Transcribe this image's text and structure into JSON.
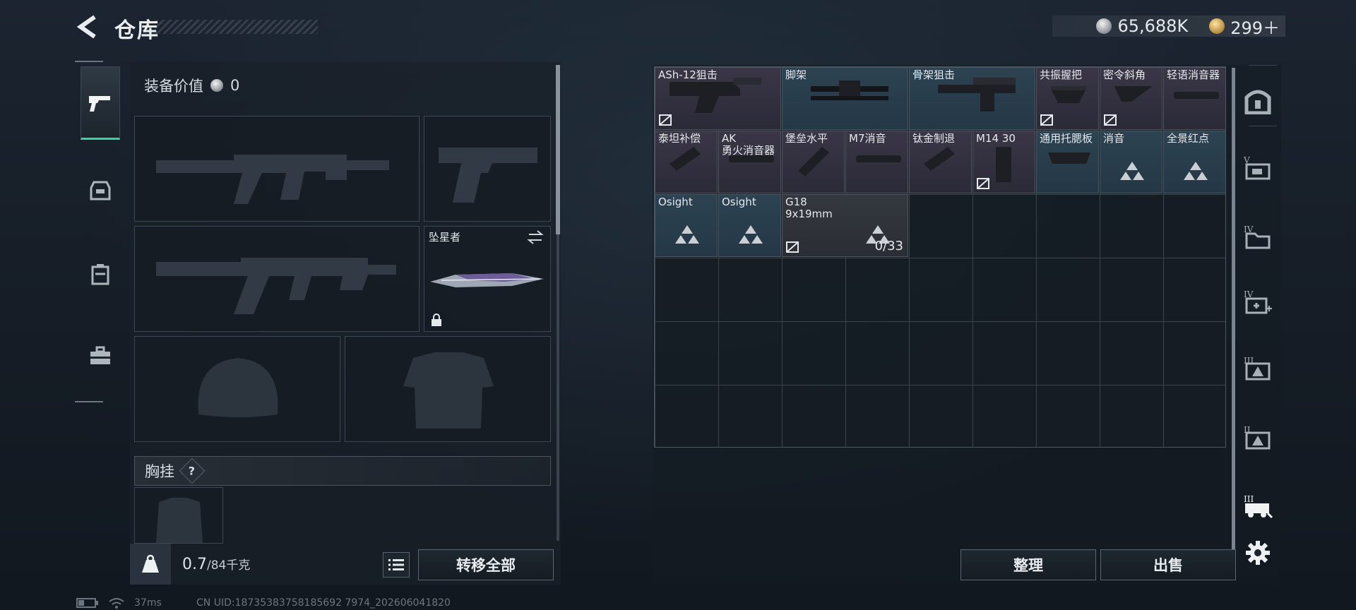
{
  "header": {
    "title": "仓库",
    "back_icon": "back-arrow-icon",
    "silver_amount": "65,688K",
    "gold_amount": "299＋"
  },
  "left_rail": [
    {
      "name": "weapons-tab",
      "icon": "pistol-icon",
      "active": true
    },
    {
      "name": "armor-tab",
      "icon": "helmet-icon",
      "active": false
    },
    {
      "name": "backpack-tab",
      "icon": "backpack-icon",
      "active": false
    },
    {
      "name": "toolbox-tab",
      "icon": "toolbox-icon",
      "active": false
    }
  ],
  "equipment": {
    "value_label": "装备价值",
    "value_amount": "0",
    "melee_name": "坠星者",
    "chest_label": "胸挂",
    "help_glyph": "?",
    "weight_current": "0.7",
    "weight_max": "/84千克",
    "transfer_all_label": "转移全部"
  },
  "stash": {
    "items": [
      {
        "name": "ASh-12狙击",
        "sub": "",
        "color": "purple",
        "locked": true
      },
      {
        "name": "脚架",
        "sub": "",
        "color": "blue",
        "locked": false
      },
      {
        "name": "骨架狙击",
        "sub": "",
        "color": "blue",
        "locked": false
      },
      {
        "name": "共振握把",
        "sub": "",
        "color": "purple",
        "locked": true
      },
      {
        "name": "密令斜角",
        "sub": "",
        "color": "purple",
        "locked": true
      },
      {
        "name": "轻语消音器",
        "sub": "",
        "color": "purple",
        "locked": false
      },
      {
        "name": "泰坦补偿",
        "sub": "",
        "color": "purple",
        "locked": false
      },
      {
        "name": "AK",
        "sub": "勇火消音器",
        "color": "purple",
        "locked": false
      },
      {
        "name": "堡垒水平",
        "sub": "",
        "color": "purple",
        "locked": false
      },
      {
        "name": "M7消音",
        "sub": "",
        "color": "purple",
        "locked": false
      },
      {
        "name": "钛金制退",
        "sub": "",
        "color": "purple",
        "locked": false
      },
      {
        "name": "M14 30",
        "sub": "",
        "color": "purple",
        "locked": true
      },
      {
        "name": "通用托腮板",
        "sub": "",
        "color": "blue",
        "locked": false
      },
      {
        "name": "消音",
        "sub": "",
        "color": "blue",
        "locked": false
      },
      {
        "name": "全景红点",
        "sub": "",
        "color": "blue",
        "locked": false
      },
      {
        "name": "Osight",
        "sub": "",
        "color": "blue",
        "locked": false
      },
      {
        "name": "Osight",
        "sub": "",
        "color": "blue",
        "locked": false
      },
      {
        "name": "G18",
        "sub": "9x19mm",
        "color": "gray",
        "locked": true,
        "count": "0/33"
      }
    ],
    "organize_label": "整理",
    "sell_label": "出售"
  },
  "right_sidebar": [
    {
      "name": "safebox-icon",
      "tier": ""
    },
    {
      "name": "tier5-equipment-icon",
      "tier": "V"
    },
    {
      "name": "tier4-folder-icon",
      "tier": "IV"
    },
    {
      "name": "tier4-medical-icon",
      "tier": "IV"
    },
    {
      "name": "tier3-warning-icon",
      "tier": "III"
    },
    {
      "name": "tier2-warning-icon",
      "tier": "II"
    },
    {
      "name": "tier3-vehicle-icon",
      "tier": "III"
    },
    {
      "name": "settings-gear-icon",
      "tier": ""
    }
  ],
  "status_bar": {
    "latency": "37ms",
    "uid": "CN UID:18735383758185692 7974_202606041820"
  },
  "colors": {
    "accent_green": "#3ad1a0",
    "item_purple": "#3a3647",
    "item_blue": "#2d4352",
    "item_gray": "#34383f"
  }
}
